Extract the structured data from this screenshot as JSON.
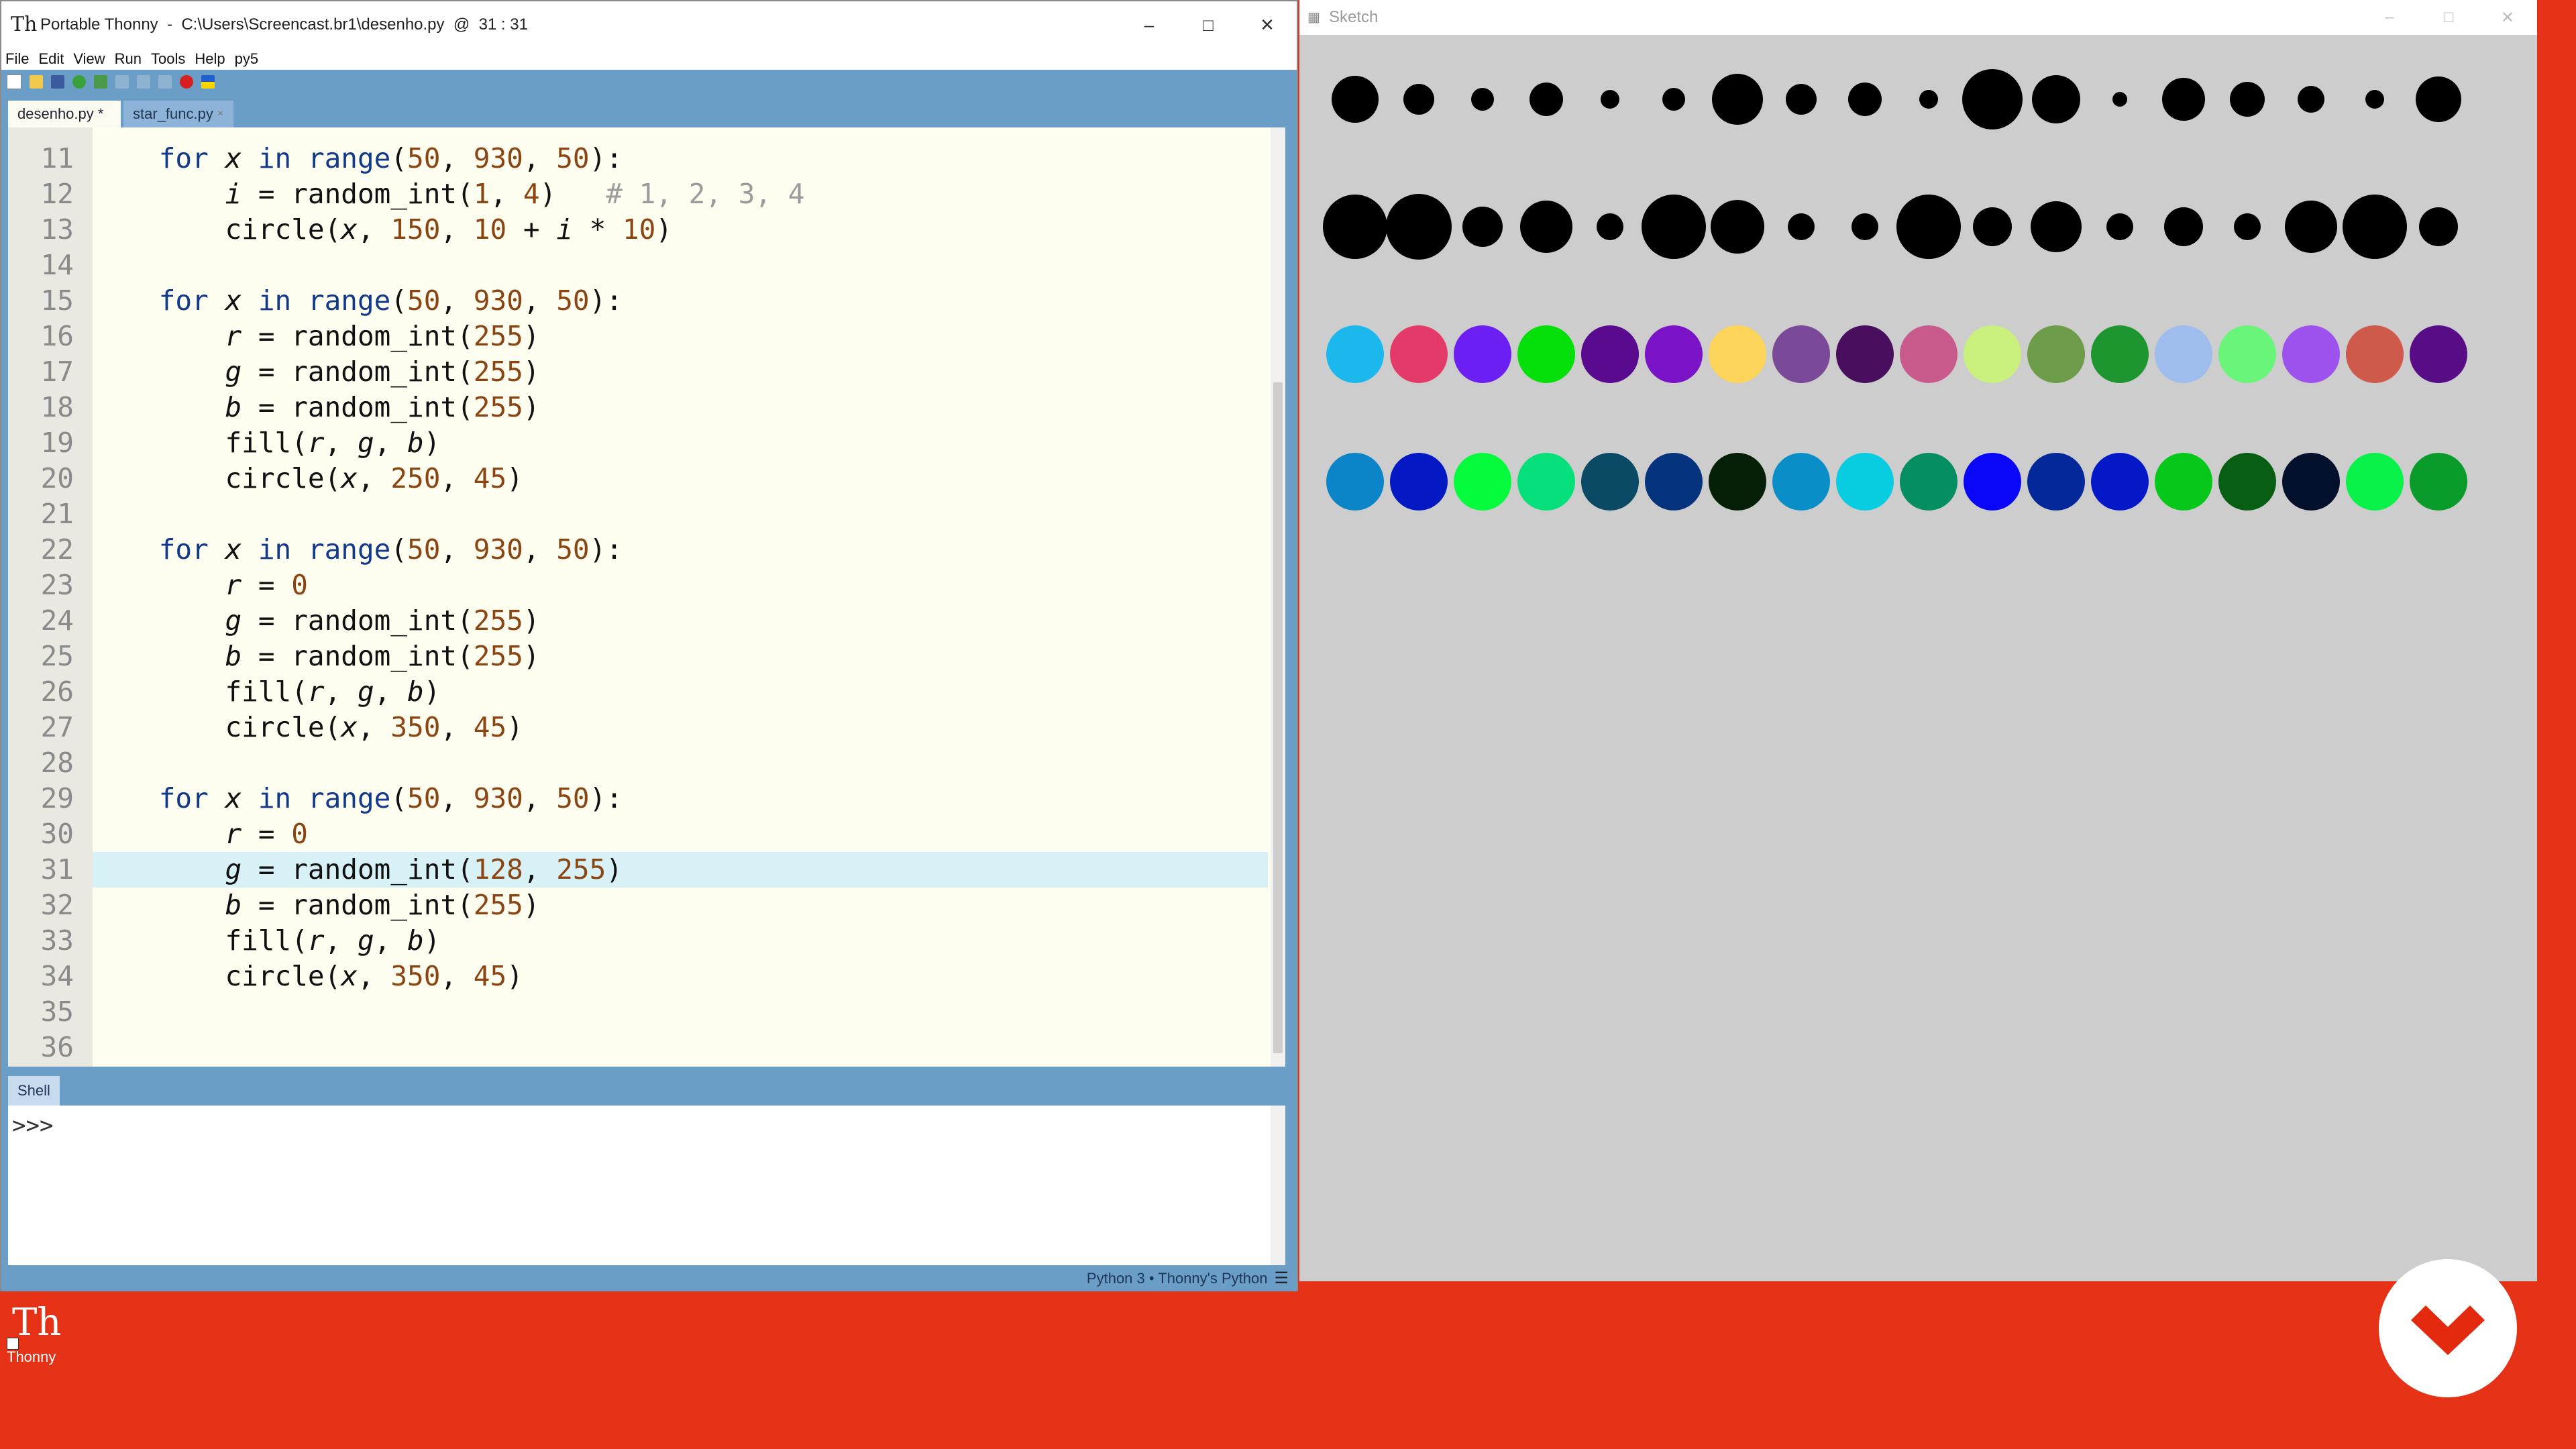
{
  "thonny": {
    "title": "Portable Thonny  -  C:\\Users\\Screencast.br1\\desenho.py  @  31 : 31",
    "menu": [
      "File",
      "Edit",
      "View",
      "Run",
      "Tools",
      "Help",
      "py5"
    ],
    "tabs": [
      {
        "label": "desenho.py *"
      },
      {
        "label": "star_func.py"
      }
    ],
    "shell_tab": "Shell",
    "shell_prompt": ">>>",
    "status": {
      "interpreter": "Python 3  •  Thonny's Python"
    },
    "code": [
      {
        "n": "11"
      },
      {
        "n": "12"
      },
      {
        "n": "13"
      },
      {
        "n": "14"
      },
      {
        "n": "15"
      },
      {
        "n": "16"
      },
      {
        "n": "17"
      },
      {
        "n": "18"
      },
      {
        "n": "19"
      },
      {
        "n": "20"
      },
      {
        "n": "21"
      },
      {
        "n": "22"
      },
      {
        "n": "23"
      },
      {
        "n": "24"
      },
      {
        "n": "25"
      },
      {
        "n": "26"
      },
      {
        "n": "27"
      },
      {
        "n": "28"
      },
      {
        "n": "29"
      },
      {
        "n": "30"
      },
      {
        "n": "31"
      },
      {
        "n": "32"
      },
      {
        "n": "33"
      },
      {
        "n": "34"
      },
      {
        "n": "35"
      },
      {
        "n": "36"
      }
    ],
    "text": {
      "for": "for",
      "in": "in",
      "range": "range",
      "x": "x",
      "i": "i",
      "r": "r",
      "g": "g",
      "b": "b",
      "eq": " = ",
      "random_int": "random_int",
      "circle": "circle",
      "fill": "fill",
      "n50": "50",
      "n930": "930",
      "n1": "1",
      "n4": "4",
      "n150": "150",
      "n10": "10",
      "n255": "255",
      "n250": "250",
      "n45": "45",
      "n0": "0",
      "n350": "350",
      "n128": "128",
      "comment": "# 1, 2, 3, 4"
    }
  },
  "sketch": {
    "title": "Sketch",
    "rows": [
      {
        "sizes": [
          70,
          46,
          34,
          50,
          28,
          34,
          76,
          46,
          50,
          28,
          90,
          72,
          22,
          64,
          52,
          40,
          28,
          68
        ]
      },
      {
        "sizes": [
          96,
          98,
          60,
          78,
          40,
          96,
          80,
          40,
          40,
          96,
          58,
          76,
          40,
          58,
          40,
          78,
          96,
          58
        ]
      },
      {
        "colors": [
          "#1ab8ec",
          "#e33a6a",
          "#6b1ff3",
          "#06e00a",
          "#5a0a8e",
          "#7a12c8",
          "#fdd45a",
          "#7a4a98",
          "#4a0e5e",
          "#c85a8c",
          "#c9f07d",
          "#6d9c4a",
          "#1e9630",
          "#9ebcec",
          "#69f57a",
          "#9d52ee",
          "#cd5a4a",
          "#580c86"
        ]
      },
      {
        "colors": [
          "#0b84c8",
          "#0418c4",
          "#05fc3c",
          "#06e07a",
          "#0a4a64",
          "#06337e",
          "#062008",
          "#0a8ec8",
          "#08cce0",
          "#058e62",
          "#0a07f8",
          "#03289a",
          "#0418c8",
          "#06c81a",
          "#085f14",
          "#03112c",
          "#08f24a",
          "#0a9c2a"
        ]
      }
    ]
  },
  "desktop": {
    "icon_label": "Thonny"
  }
}
